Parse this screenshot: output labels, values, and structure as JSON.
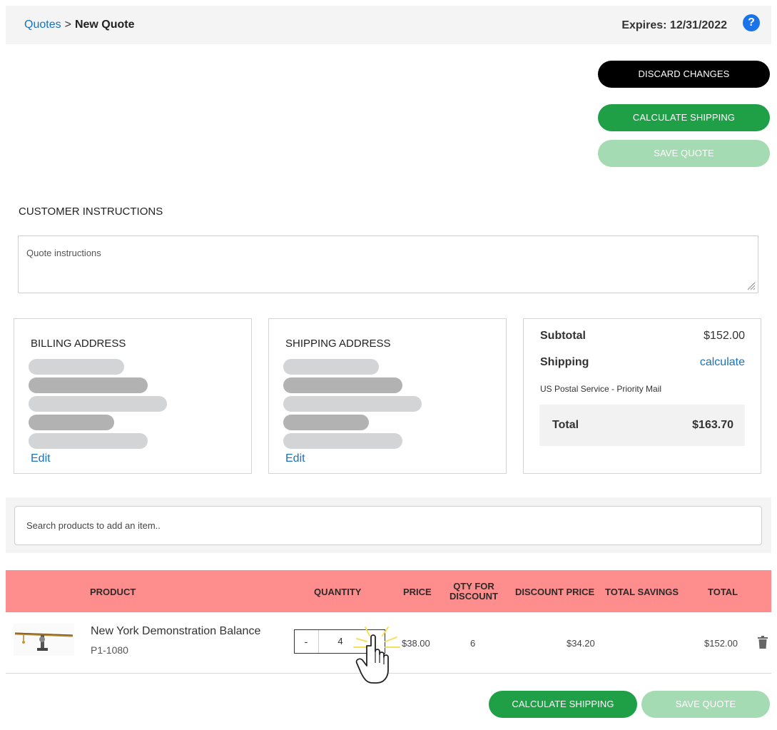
{
  "breadcrumb": {
    "parent": "Quotes",
    "separator": ">",
    "current": "New Quote"
  },
  "header": {
    "expires": "Expires: 12/31/2022",
    "help_glyph": "?"
  },
  "actions": {
    "discard": "DISCARD CHANGES",
    "calculate_shipping": "CALCULATE SHIPPING",
    "save_quote": "SAVE QUOTE"
  },
  "instructions": {
    "label": "CUSTOMER INSTRUCTIONS",
    "placeholder": "Quote instructions"
  },
  "billing": {
    "title": "BILLING ADDRESS",
    "edit": "Edit"
  },
  "shipping": {
    "title": "SHIPPING ADDRESS",
    "edit": "Edit"
  },
  "summary": {
    "subtotal_label": "Subtotal",
    "subtotal": "$152.00",
    "shipping_label": "Shipping",
    "shipping_link": "calculate",
    "carrier": "US Postal Service - Priority Mail",
    "total_label": "Total",
    "total": "$163.70"
  },
  "search": {
    "placeholder": "Search products to add an item.."
  },
  "table": {
    "headers": {
      "product": "PRODUCT",
      "quantity": "QUANTITY",
      "price": "PRICE",
      "qty_for_discount_1": "QTY FOR",
      "qty_for_discount_2": "DISCOUNT",
      "discount_price": "DISCOUNT PRICE",
      "total_savings": "TOTAL SAVINGS",
      "total": "TOTAL"
    },
    "rows": [
      {
        "name": "New York Demonstration Balance",
        "sku": "P1-1080",
        "minus": "-",
        "quantity": "4",
        "plus": "+",
        "price": "$38.00",
        "qty_for_discount": "6",
        "discount_price": "$34.20",
        "total_savings": "",
        "total": "$152.00"
      }
    ]
  },
  "colors": {
    "accent_green": "#1fa046",
    "pale_green": "#a5dbb3",
    "link_blue": "#1a73b8",
    "table_header": "#fe8e8e"
  }
}
